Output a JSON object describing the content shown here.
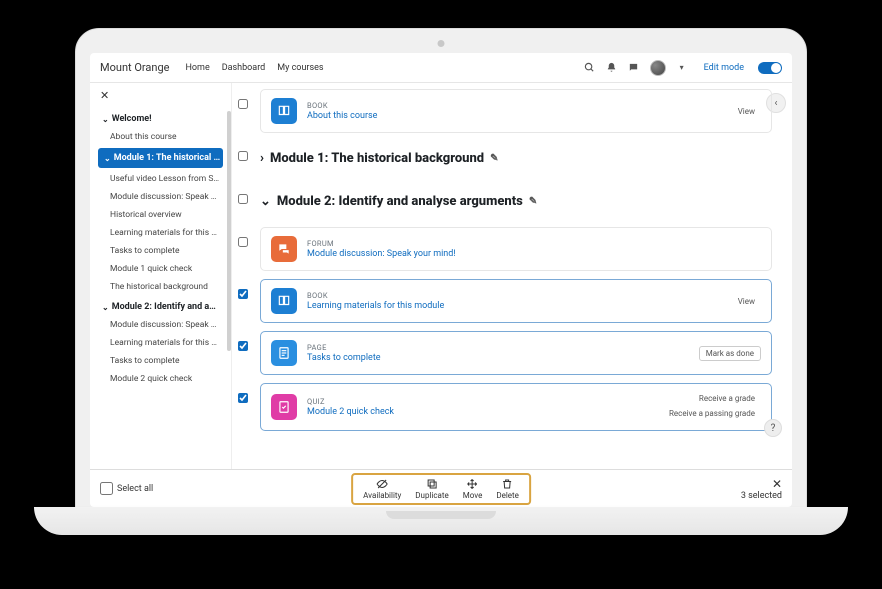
{
  "brand": "Mount Orange",
  "nav": {
    "home": "Home",
    "dashboard": "Dashboard",
    "mycourses": "My courses",
    "editmode": "Edit mode"
  },
  "sidebar": {
    "welcome_section": "Welcome!",
    "welcome_items": [
      "About this course"
    ],
    "mod1_section": "Module 1: The historical …",
    "mod1_items": [
      "Useful video Lesson from S…",
      "Module discussion: Speak …",
      "Historical overview",
      "Learning materials for this …",
      "Tasks to complete",
      "Module 1 quick check",
      "The historical background"
    ],
    "mod2_section": "Module 2: Identify and a…",
    "mod2_items": [
      "Module discussion: Speak …",
      "Learning materials for this …",
      "Tasks to complete",
      "Module 2 quick check"
    ]
  },
  "main": {
    "card_book_type": "BOOK",
    "card_book_link": "About this course",
    "book_view": "View",
    "mod1_title": "Module 1: The historical background",
    "mod2_title": "Module 2: Identify and analyse arguments",
    "forum_type": "FORUM",
    "forum_link": "Module discussion: Speak your mind!",
    "book2_type": "BOOK",
    "book2_link": "Learning materials for this module",
    "book2_view": "View",
    "page_type": "PAGE",
    "page_link": "Tasks to complete",
    "page_mark": "Mark as done",
    "quiz_type": "QUIZ",
    "quiz_link": "Module 2 quick check",
    "quiz_tag1": "Receive a grade",
    "quiz_tag2": "Receive a passing grade"
  },
  "bulk": {
    "select_all": "Select all",
    "availability": "Availability",
    "duplicate": "Duplicate",
    "move": "Move",
    "delete": "Delete",
    "selected": "3 selected"
  }
}
